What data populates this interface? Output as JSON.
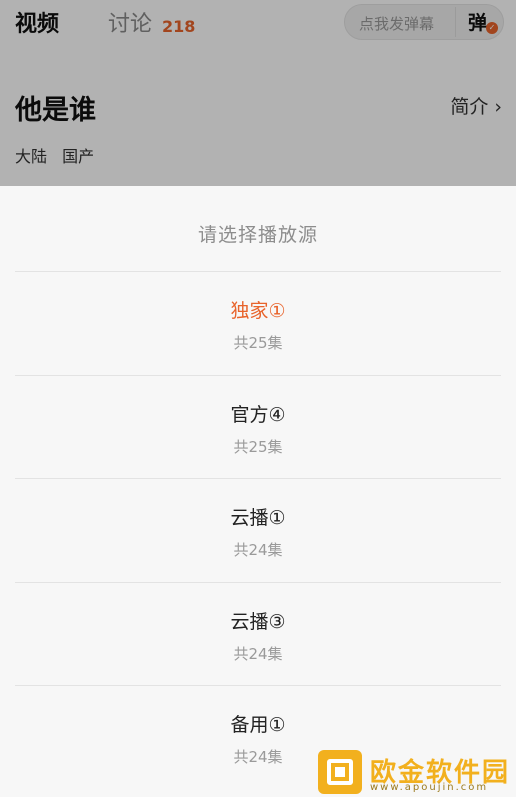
{
  "header": {
    "tab_video": "视频",
    "tab_discuss": "讨论",
    "discuss_count": "218",
    "danmu_placeholder": "点我发弹幕",
    "danmu_toggle": "弹"
  },
  "show": {
    "title": "他是谁",
    "intro_label": "简介",
    "tags": [
      "大陆",
      "国产"
    ]
  },
  "sheet": {
    "title": "请选择播放源",
    "sources": [
      {
        "name": "独家①",
        "count": "共25集",
        "selected": true
      },
      {
        "name": "官方④",
        "count": "共25集",
        "selected": false
      },
      {
        "name": "云播①",
        "count": "共24集",
        "selected": false
      },
      {
        "name": "云播③",
        "count": "共24集",
        "selected": false
      },
      {
        "name": "备用①",
        "count": "共24集",
        "selected": false
      }
    ]
  },
  "watermark": {
    "text": "欧金软件园",
    "url": "www.apoujin.com"
  },
  "colors": {
    "accent": "#e8632b",
    "watermark": "#f2b01e"
  }
}
